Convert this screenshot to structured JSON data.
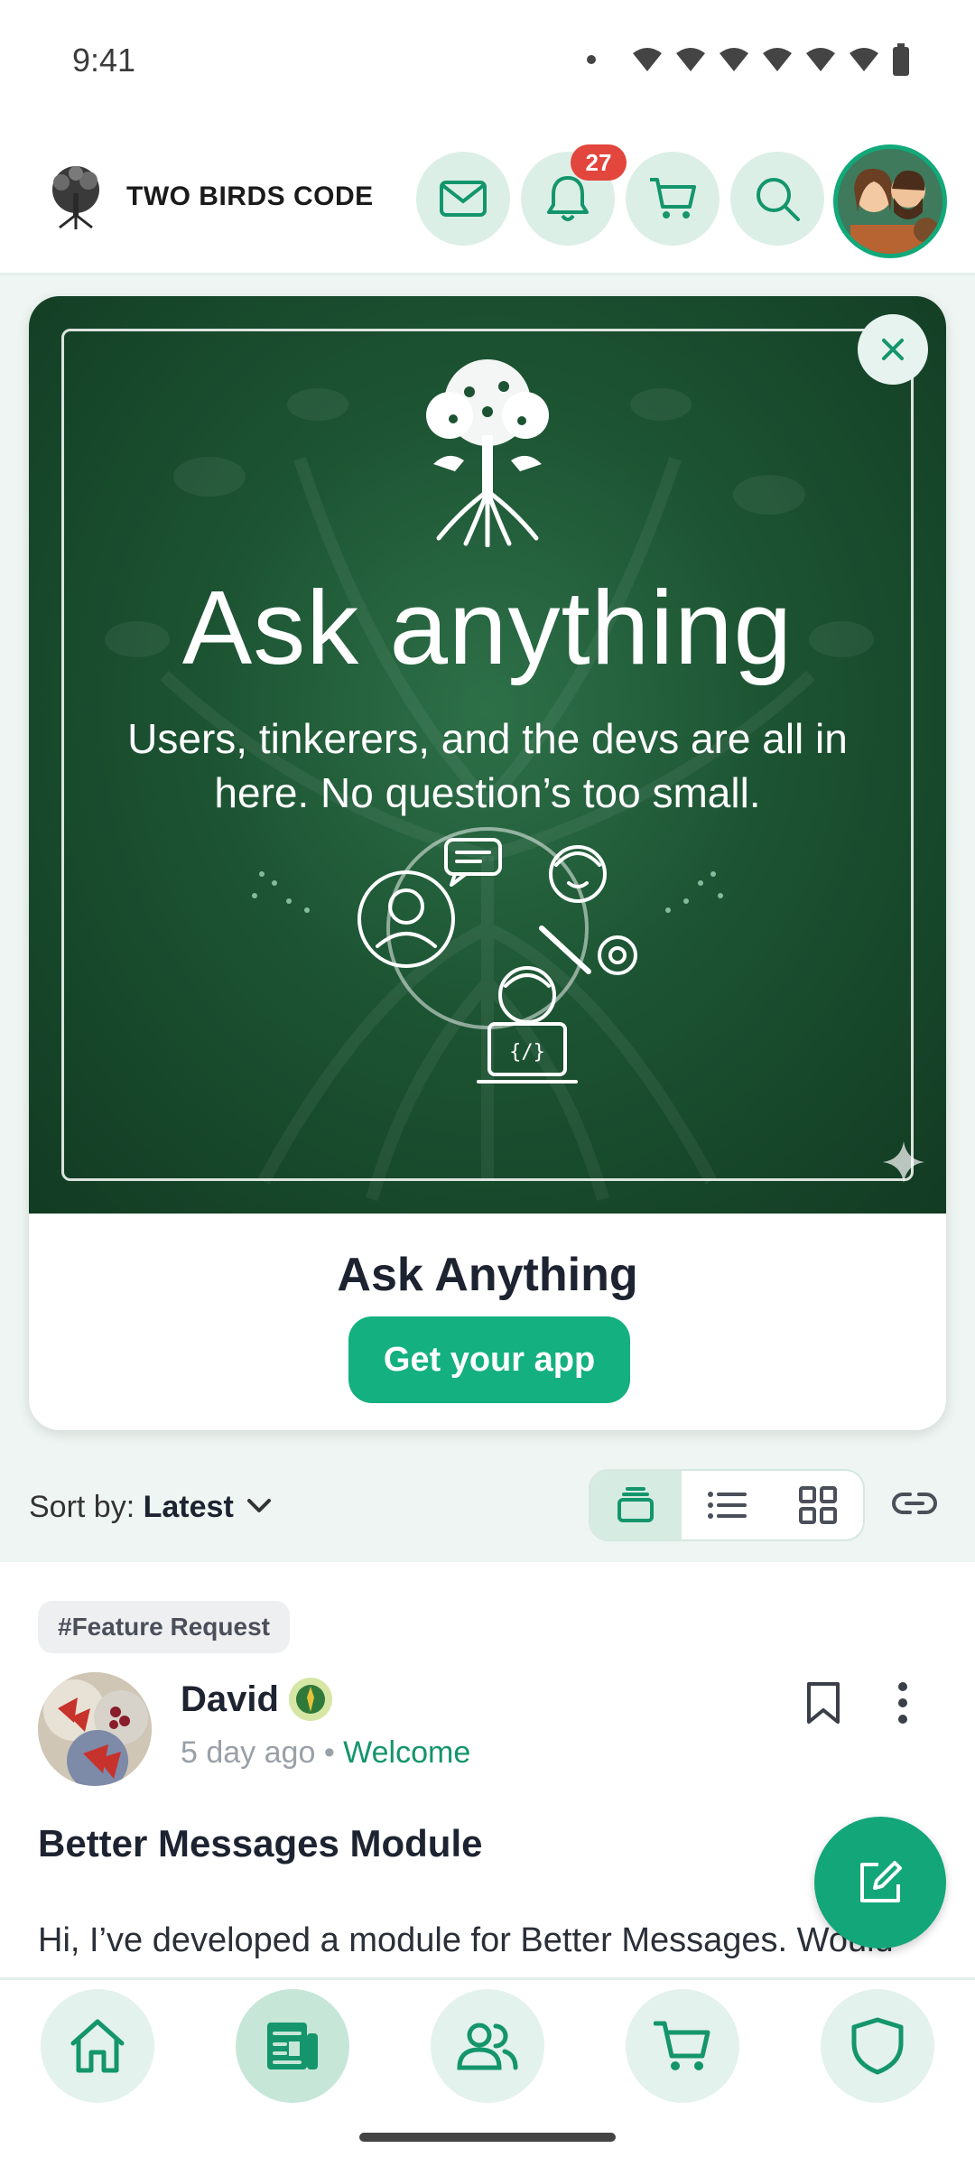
{
  "status_bar": {
    "time": "9:41"
  },
  "header": {
    "brand": "TWO BIRDS CODE",
    "notification_count": "27"
  },
  "promo": {
    "headline": "Ask anything",
    "subtext": "Users, tinkerers, and the devs are all in here. No question’s too small.",
    "title": "Ask Anything",
    "cta_label": "Get your app"
  },
  "feed": {
    "sort_prefix": "Sort by:",
    "sort_value": "Latest"
  },
  "post": {
    "tag": "#Feature Request",
    "author": "David",
    "time_ago": "5 day ago",
    "separator": "•",
    "forum": "Welcome",
    "title": "Better Messages Module",
    "excerpt": "Hi, I’ve developed a module for Better Messages. Would"
  },
  "colors": {
    "accent": "#14b07f",
    "accent_light": "#dcefe7",
    "badge": "#e2463c",
    "promo_bg": "#1c5332"
  },
  "icons": {
    "header": [
      "mail-icon",
      "bell-icon",
      "cart-icon",
      "search-icon"
    ],
    "bottom_nav": [
      "home-icon",
      "news-feed-icon",
      "members-icon",
      "cart-icon",
      "shield-icon"
    ]
  }
}
